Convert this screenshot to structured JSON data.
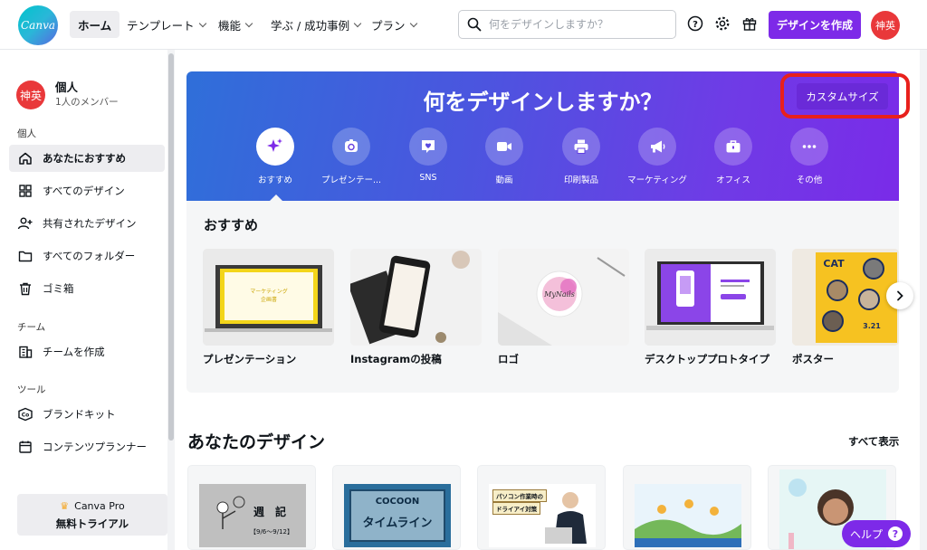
{
  "header": {
    "logo_text": "Canva",
    "nav": [
      {
        "label": "ホーム",
        "dropdown": false,
        "active": true
      },
      {
        "label": "テンプレート",
        "dropdown": true
      },
      {
        "label": "機能",
        "dropdown": true
      },
      {
        "label": "学ぶ / 成功事例",
        "dropdown": true
      },
      {
        "label": "プラン",
        "dropdown": true
      }
    ],
    "search_placeholder": "何をデザインしますか？",
    "create_button": "デザインを作成",
    "avatar_text": "神英"
  },
  "sidebar": {
    "account_avatar": "神英",
    "account_name": "個人",
    "account_sub": "1人のメンバー",
    "section_personal": "個人",
    "items_personal": [
      {
        "label": "あなたにおすすめ",
        "icon": "home-icon",
        "active": true
      },
      {
        "label": "すべてのデザイン",
        "icon": "grid-icon"
      },
      {
        "label": "共有されたデザイン",
        "icon": "shared-users-icon"
      },
      {
        "label": "すべてのフォルダー",
        "icon": "folder-icon"
      },
      {
        "label": "ゴミ箱",
        "icon": "trash-icon"
      }
    ],
    "section_team": "チーム",
    "items_team": [
      {
        "label": "チームを作成",
        "icon": "team-building-icon"
      }
    ],
    "section_tools": "ツール",
    "items_tools": [
      {
        "label": "ブランドキット",
        "icon": "brand-kit-icon"
      },
      {
        "label": "コンテンツプランナー",
        "icon": "calendar-icon"
      }
    ],
    "pro_line1": "Canva Pro",
    "pro_line2": "無料トライアル"
  },
  "hero": {
    "title": "何をデザインしますか？",
    "custom_size": "カスタムサイズ",
    "categories": [
      {
        "label": "おすすめ",
        "icon": "sparkle-icon",
        "active": true
      },
      {
        "label": "プレゼンテー...",
        "icon": "presentation-icon"
      },
      {
        "label": "SNS",
        "icon": "heart-chat-icon"
      },
      {
        "label": "動画",
        "icon": "video-icon"
      },
      {
        "label": "印刷製品",
        "icon": "printer-icon"
      },
      {
        "label": "マーケティング",
        "icon": "megaphone-icon"
      },
      {
        "label": "オフィス",
        "icon": "briefcase-icon"
      },
      {
        "label": "その他",
        "icon": "more-dots-icon"
      }
    ]
  },
  "recommended": {
    "title": "おすすめ",
    "cards": [
      {
        "label": "プレゼンテーション",
        "thumb_title": "マーケティング\n企画書"
      },
      {
        "label": "Instagramの投稿",
        "thumb_title": ""
      },
      {
        "label": "ロゴ",
        "thumb_title": "MyNails"
      },
      {
        "label": "デスクトッププロトタイプ",
        "thumb_title": ""
      },
      {
        "label": "ポスター",
        "thumb_title": "CAT PROJECT"
      }
    ]
  },
  "your_designs": {
    "title": "あなたのデザイン",
    "see_all": "すべて表示",
    "cards": [
      {
        "text1": "週　記",
        "text2": "【9/6〜9/12】"
      },
      {
        "text1": "COCOON",
        "text2": "タイムライン"
      },
      {
        "text1": "パソコン作業時の",
        "text2": "ドライアイ対策"
      },
      {
        "text1": "",
        "text2": ""
      },
      {
        "text1": "",
        "text2": ""
      }
    ]
  },
  "help": "ヘルプ",
  "colors": {
    "accent": "#7d2ae8",
    "highlight": "#e8201c",
    "canva_teal": "#00c4cc"
  }
}
